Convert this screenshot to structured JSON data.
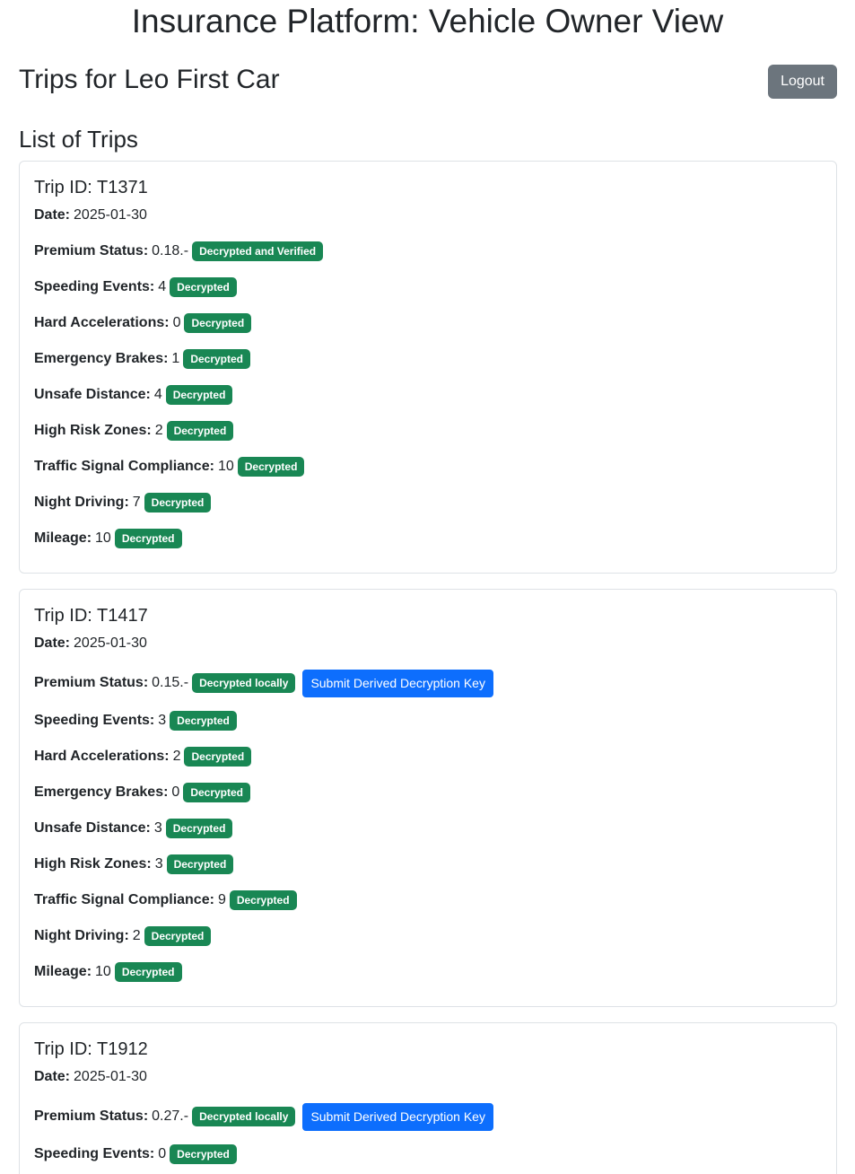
{
  "header": {
    "app_title": "Insurance Platform: Vehicle Owner View",
    "page_title": "Trips for Leo First Car",
    "logout_label": "Logout"
  },
  "section_title": "List of Trips",
  "colors": {
    "badge_success": "#198754",
    "primary_button": "#0d6efd",
    "secondary_button": "#6c757d"
  },
  "trips": [
    {
      "title": "Trip ID: T1371",
      "date_label": "Date:",
      "date": "2025-01-30",
      "premium_label": "Premium Status:",
      "premium_value": "0.18.-",
      "premium_badge": "Decrypted and Verified",
      "fields": [
        {
          "label": "Speeding Events:",
          "value": "4",
          "badge": "Decrypted"
        },
        {
          "label": "Hard Accelerations:",
          "value": "0",
          "badge": "Decrypted"
        },
        {
          "label": "Emergency Brakes:",
          "value": "1",
          "badge": "Decrypted"
        },
        {
          "label": "Unsafe Distance:",
          "value": "4",
          "badge": "Decrypted"
        },
        {
          "label": "High Risk Zones:",
          "value": "2",
          "badge": "Decrypted"
        },
        {
          "label": "Traffic Signal Compliance:",
          "value": "10",
          "badge": "Decrypted"
        },
        {
          "label": "Night Driving:",
          "value": "7",
          "badge": "Decrypted"
        },
        {
          "label": "Mileage:",
          "value": "10",
          "badge": "Decrypted"
        }
      ]
    },
    {
      "title": "Trip ID: T1417",
      "date_label": "Date:",
      "date": "2025-01-30",
      "premium_label": "Premium Status:",
      "premium_value": "0.15.-",
      "premium_badge": "Decrypted locally",
      "submit_label": "Submit Derived Decryption Key",
      "fields": [
        {
          "label": "Speeding Events:",
          "value": "3",
          "badge": "Decrypted"
        },
        {
          "label": "Hard Accelerations:",
          "value": "2",
          "badge": "Decrypted"
        },
        {
          "label": "Emergency Brakes:",
          "value": "0",
          "badge": "Decrypted"
        },
        {
          "label": "Unsafe Distance:",
          "value": "3",
          "badge": "Decrypted"
        },
        {
          "label": "High Risk Zones:",
          "value": "3",
          "badge": "Decrypted"
        },
        {
          "label": "Traffic Signal Compliance:",
          "value": "9",
          "badge": "Decrypted"
        },
        {
          "label": "Night Driving:",
          "value": "2",
          "badge": "Decrypted"
        },
        {
          "label": "Mileage:",
          "value": "10",
          "badge": "Decrypted"
        }
      ]
    },
    {
      "title": "Trip ID: T1912",
      "date_label": "Date:",
      "date": "2025-01-30",
      "premium_label": "Premium Status:",
      "premium_value": "0.27.-",
      "premium_badge": "Decrypted locally",
      "submit_label": "Submit Derived Decryption Key",
      "fields": [
        {
          "label": "Speeding Events:",
          "value": "0",
          "badge": "Decrypted"
        }
      ]
    }
  ]
}
